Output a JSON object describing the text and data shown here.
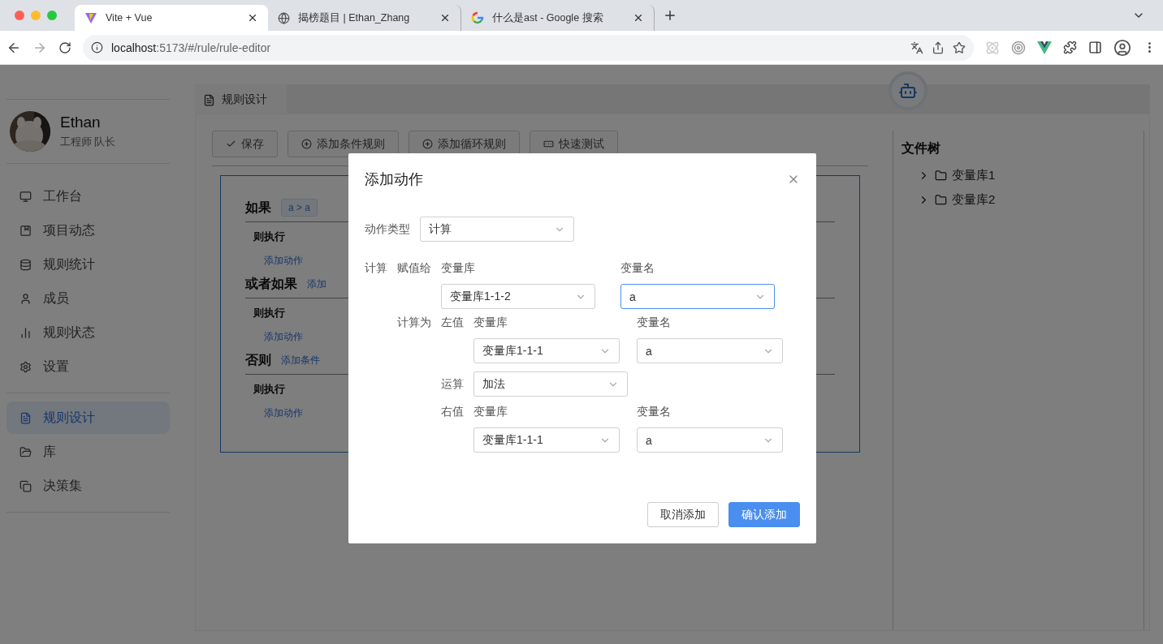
{
  "browser": {
    "tabs": [
      {
        "title": "Vite + Vue",
        "selected": true
      },
      {
        "title": "揭榜题目 | Ethan_Zhang",
        "selected": false
      },
      {
        "title": "什么是ast - Google 搜索",
        "selected": false
      }
    ],
    "url_host": "localhost",
    "url_path": ":5173/#/rule/rule-editor"
  },
  "sidebar": {
    "user": {
      "name": "Ethan",
      "role": "工程师 队长"
    },
    "groups": [
      [
        {
          "label": "工作台",
          "selected": false
        },
        {
          "label": "项目动态",
          "selected": false
        },
        {
          "label": "规则统计",
          "selected": false
        },
        {
          "label": "成员",
          "selected": false
        },
        {
          "label": "规则状态",
          "selected": false
        },
        {
          "label": "设置",
          "selected": false
        }
      ],
      [
        {
          "label": "规则设计",
          "selected": true
        },
        {
          "label": "库",
          "selected": false
        },
        {
          "label": "决策集",
          "selected": false
        }
      ]
    ]
  },
  "main": {
    "tabs": [
      {
        "label": "规则设计",
        "selected": true
      }
    ],
    "toolbar": [
      {
        "label": "保存"
      },
      {
        "label": "添加条件规则"
      },
      {
        "label": "添加循环规则"
      },
      {
        "label": "快速测试"
      }
    ],
    "rule_sections": [
      {
        "title": "如果",
        "chip": "a > a",
        "then_label": "则执行",
        "action_link": "添加动作"
      },
      {
        "title": "或者如果",
        "link": "添加",
        "then_label": "则执行",
        "action_link": "添加动作"
      },
      {
        "title": "否则",
        "link": "添加条件",
        "then_label": "则执行",
        "action_link": "添加动作"
      }
    ],
    "file_tree": {
      "title": "文件树",
      "items": [
        {
          "label": "变量库1",
          "expanded": false
        },
        {
          "label": "变量库2",
          "expanded": false
        }
      ]
    }
  },
  "dialog": {
    "title": "添加动作",
    "action_type": {
      "label": "动作类型",
      "value": "计算"
    },
    "section_label": "计算",
    "assign": {
      "label": "赋值给",
      "lib": {
        "label": "变量库",
        "value": "变量库1-1-2",
        "focused": false
      },
      "name": {
        "label": "变量名",
        "value": "a",
        "focused": true
      }
    },
    "compute": {
      "label": "计算为",
      "left": {
        "label": "左值",
        "lib": {
          "label": "变量库",
          "value": "变量库1-1-1",
          "focused": false
        },
        "name": {
          "label": "变量名",
          "value": "a",
          "focused": false
        }
      },
      "op": {
        "label": "运算",
        "value": "加法"
      },
      "right": {
        "label": "右值",
        "lib": {
          "label": "变量库",
          "value": "变量库1-1-1",
          "focused": false
        },
        "name": {
          "label": "变量名",
          "value": "a",
          "focused": false
        }
      }
    },
    "buttons": [
      {
        "label": "取消添加",
        "primary": false
      },
      {
        "label": "确认添加",
        "primary": true
      }
    ]
  }
}
